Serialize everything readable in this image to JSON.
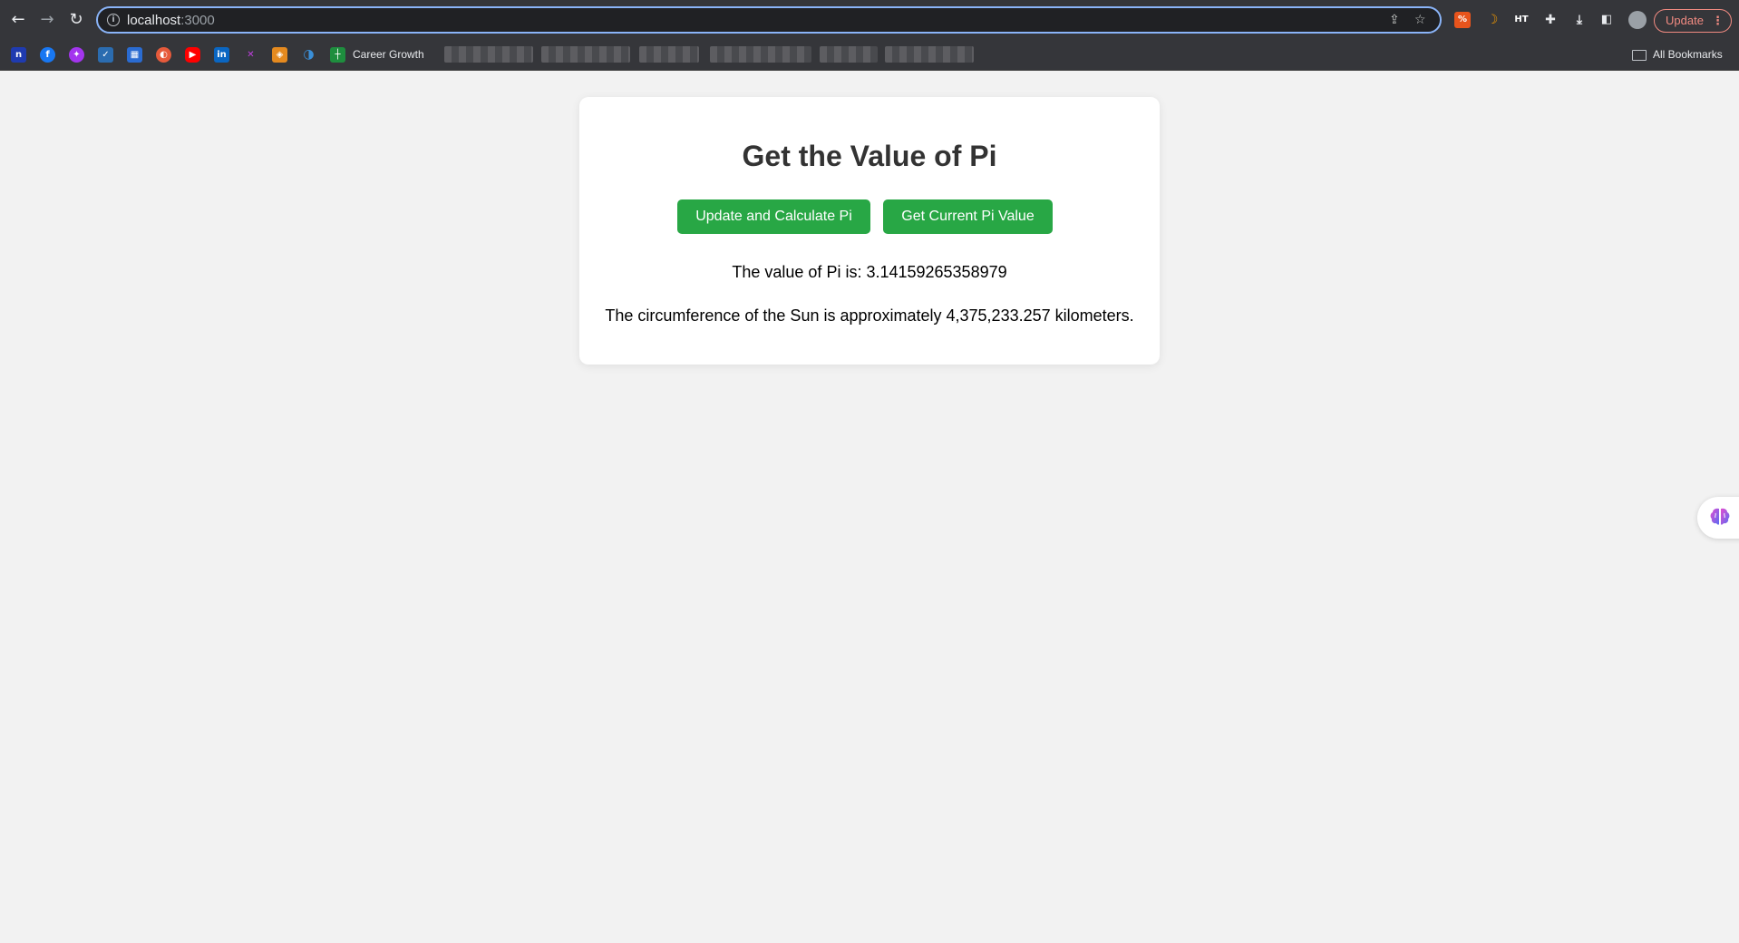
{
  "browser": {
    "url_host": "localhost",
    "url_port": ":3000",
    "update_label": "Update",
    "update_menu": "⋮",
    "extensions": [
      {
        "name": "percent-extension-icon",
        "glyph": "%",
        "color": "#e8541c"
      },
      {
        "name": "crescent-extension-icon",
        "glyph": "",
        "color": "#35363a"
      },
      {
        "name": "ht-extension-icon",
        "glyph": "HT",
        "color": "#35363a"
      }
    ]
  },
  "bookmarks": {
    "items": [
      {
        "name": "naukri-bookmark-icon",
        "glyph": "n",
        "color": "#1f3bb0"
      },
      {
        "name": "facebook-bookmark-icon",
        "glyph": "f",
        "color": "#1877f2"
      },
      {
        "name": "messenger-bookmark-icon",
        "glyph": "✦",
        "color": "#a335ee"
      },
      {
        "name": "todo-bookmark-icon",
        "glyph": "✓",
        "color": "#2b6cb0"
      },
      {
        "name": "grid-bookmark-icon",
        "glyph": "▦",
        "color": "#2a6bd1"
      },
      {
        "name": "orange-bookmark-icon",
        "glyph": "◐",
        "color": "#e65a3b"
      },
      {
        "name": "youtube-bookmark-icon",
        "glyph": "▶",
        "color": "#ff0000"
      },
      {
        "name": "linkedin-bookmark-icon",
        "glyph": "in",
        "color": "#0a66c2"
      },
      {
        "name": "purple-bookmark-icon",
        "glyph": "✕",
        "color": "#b13fd6"
      },
      {
        "name": "shield-bookmark-icon",
        "glyph": "◈",
        "color": "#e58a1f"
      },
      {
        "name": "blue-circle-bookmark-icon",
        "glyph": "◑",
        "color": "#3a8fd8"
      },
      {
        "name": "sheets-bookmark-icon",
        "glyph": "┼",
        "color": "#1e8e3e"
      }
    ],
    "career_growth": "Career Growth",
    "all_bookmarks": "All Bookmarks"
  },
  "page": {
    "title": "Get the Value of Pi",
    "update_button": "Update and Calculate Pi",
    "get_button": "Get Current Pi Value",
    "pi_text": "The value of Pi is: 3.14159265358979",
    "sun_text": "The circumference of the Sun is approximately 4,375,233.257 kilometers."
  },
  "colors": {
    "button_green": "#28a745",
    "page_bg": "#f2f2f2",
    "title_color": "#333333"
  }
}
